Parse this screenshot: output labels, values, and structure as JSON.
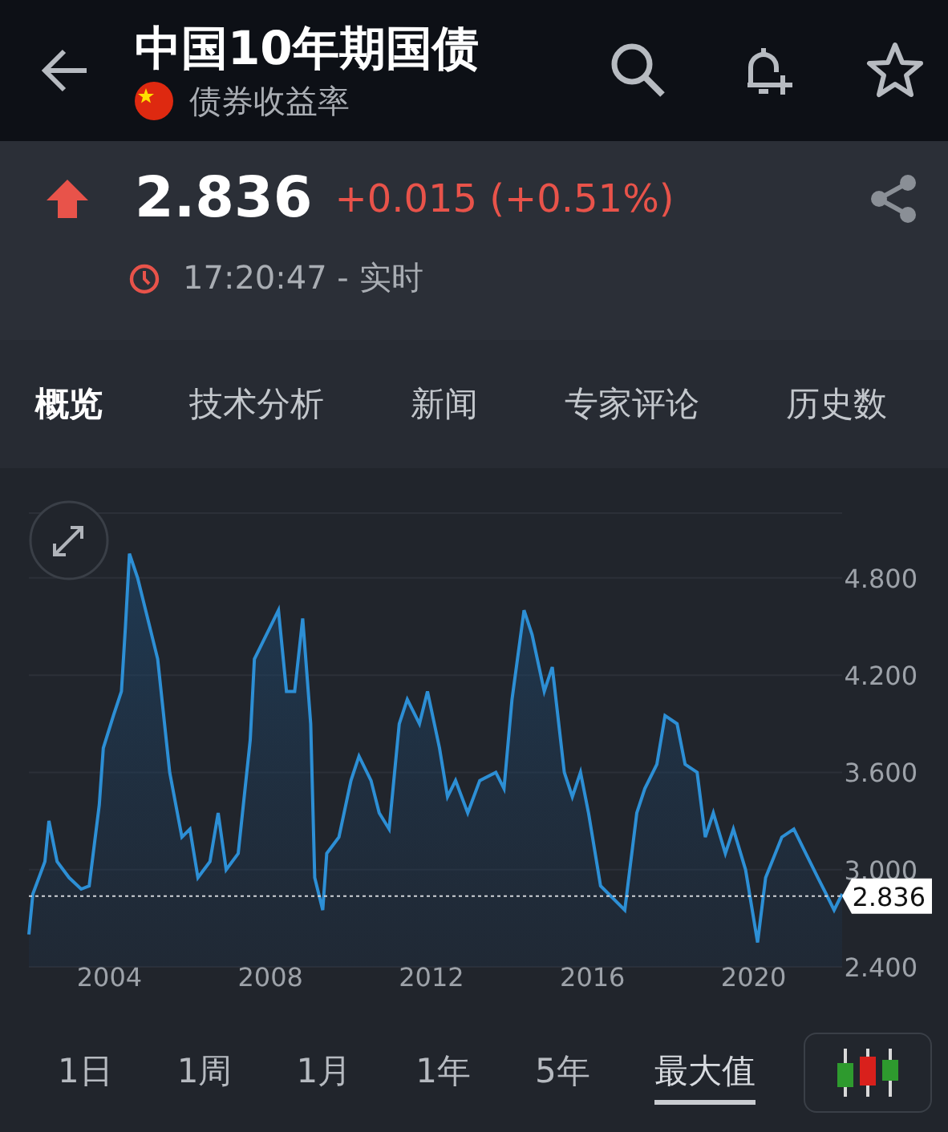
{
  "header": {
    "title": "中国10年期国债",
    "subtitle": "债券收益率"
  },
  "quote": {
    "rising": true,
    "price": "2.836",
    "change": "+0.015 (+0.51%)",
    "time": "17:20:47 - 实时"
  },
  "tabs": [
    {
      "label": "概览",
      "selected": true
    },
    {
      "label": "技术分析",
      "selected": false
    },
    {
      "label": "新闻",
      "selected": false
    },
    {
      "label": "专家评论",
      "selected": false
    },
    {
      "label": "历史数",
      "selected": false
    }
  ],
  "chart": {
    "chart_data": {
      "type": "area",
      "grid": true,
      "xlim": [
        2002,
        2022.2
      ],
      "ylim": [
        2.4,
        5.2
      ],
      "xticks": [
        2004,
        2008,
        2012,
        2016,
        2020
      ],
      "yticks": [
        {
          "value": 4.8,
          "label": "4.800"
        },
        {
          "value": 4.2,
          "label": "4.200"
        },
        {
          "value": 3.6,
          "label": "3.600"
        },
        {
          "value": 3.0,
          "label": "3.000"
        },
        {
          "value": 2.4,
          "label": "2.400"
        }
      ],
      "x": [
        2002.0,
        2002.1,
        2002.4,
        2002.5,
        2002.7,
        2003.0,
        2003.3,
        2003.5,
        2003.75,
        2003.85,
        2004.1,
        2004.3,
        2004.4,
        2004.5,
        2004.7,
        2004.9,
        2005.2,
        2005.5,
        2005.8,
        2006.0,
        2006.2,
        2006.5,
        2006.7,
        2006.9,
        2007.2,
        2007.5,
        2007.6,
        2007.9,
        2008.2,
        2008.4,
        2008.6,
        2008.8,
        2009.0,
        2009.1,
        2009.3,
        2009.4,
        2009.7,
        2010.0,
        2010.2,
        2010.5,
        2010.7,
        2010.95,
        2011.2,
        2011.4,
        2011.7,
        2011.9,
        2012.2,
        2012.4,
        2012.6,
        2012.9,
        2013.2,
        2013.6,
        2013.8,
        2014.0,
        2014.3,
        2014.5,
        2014.8,
        2015.0,
        2015.3,
        2015.5,
        2015.7,
        2015.9,
        2016.2,
        2016.4,
        2016.8,
        2017.1,
        2017.3,
        2017.6,
        2017.8,
        2018.1,
        2018.3,
        2018.6,
        2018.8,
        2019.0,
        2019.3,
        2019.5,
        2019.8,
        2020.1,
        2020.3,
        2020.7,
        2021.0,
        2021.3,
        2021.6,
        2021.8,
        2022.0,
        2022.2
      ],
      "series": [
        {
          "color": "#2d8fd5",
          "values": [
            2.6,
            2.85,
            3.05,
            3.3,
            3.05,
            2.95,
            2.88,
            2.9,
            3.4,
            3.75,
            3.95,
            4.1,
            4.5,
            4.95,
            4.8,
            4.6,
            4.3,
            3.6,
            3.2,
            3.25,
            2.95,
            3.05,
            3.35,
            3.0,
            3.1,
            3.8,
            4.3,
            4.45,
            4.6,
            4.1,
            4.1,
            4.55,
            3.9,
            2.95,
            2.75,
            3.1,
            3.2,
            3.55,
            3.7,
            3.55,
            3.35,
            3.25,
            3.9,
            4.05,
            3.9,
            4.1,
            3.75,
            3.45,
            3.55,
            3.35,
            3.55,
            3.6,
            3.5,
            4.05,
            4.6,
            4.45,
            4.1,
            4.25,
            3.6,
            3.45,
            3.6,
            3.35,
            2.9,
            2.85,
            2.75,
            3.35,
            3.5,
            3.65,
            3.95,
            3.9,
            3.65,
            3.6,
            3.2,
            3.35,
            3.1,
            3.25,
            3.0,
            2.55,
            2.95,
            3.2,
            3.25,
            3.1,
            2.95,
            2.85,
            2.75,
            2.85
          ]
        }
      ],
      "ref_lines": [
        {
          "label": "2.836"
        }
      ]
    }
  },
  "ranges": [
    {
      "label": "1日",
      "selected": false
    },
    {
      "label": "1周",
      "selected": false
    },
    {
      "label": "1月",
      "selected": false
    },
    {
      "label": "1年",
      "selected": false
    },
    {
      "label": "5年",
      "selected": false
    },
    {
      "label": "最大值",
      "selected": true
    }
  ]
}
